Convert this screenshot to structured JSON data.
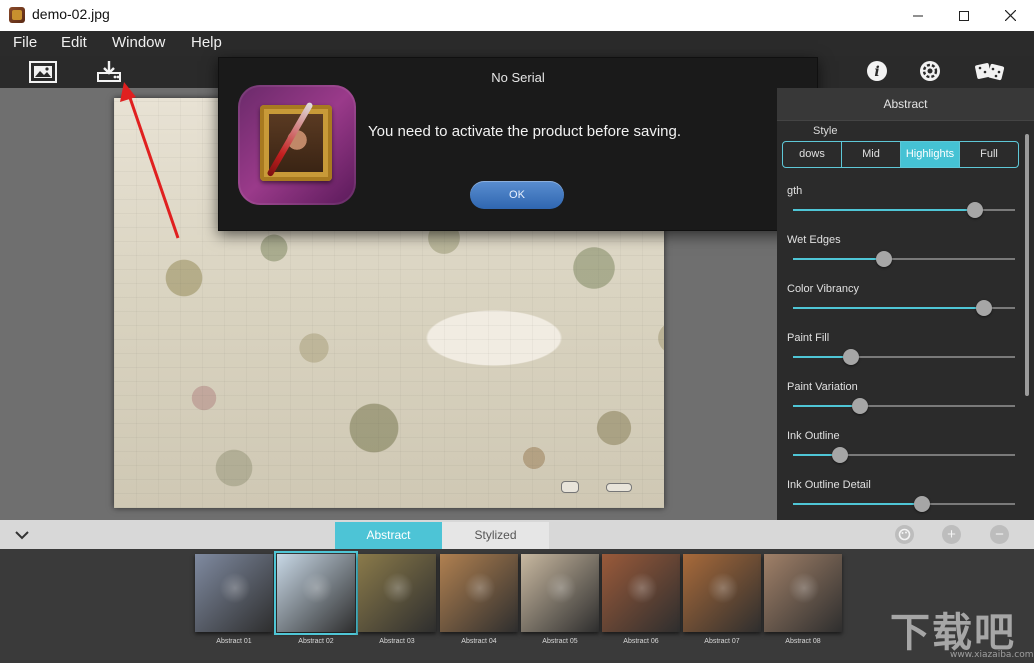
{
  "window": {
    "title": "demo-02.jpg"
  },
  "menu": [
    "File",
    "Edit",
    "Window",
    "Help"
  ],
  "toolbar": {
    "left_icons": [
      "image-icon",
      "save-download-icon"
    ],
    "right_icons": [
      "info-icon",
      "settings-gear-icon",
      "dice-icon"
    ]
  },
  "dialog": {
    "title": "No Serial",
    "message": "You need to activate the product before saving.",
    "ok_label": "OK"
  },
  "panel": {
    "title": "Abstract",
    "style_label": "Style",
    "style_options": [
      "dows",
      "Mid",
      "Highlights",
      "Full"
    ],
    "style_selected": "Highlights",
    "sliders": [
      {
        "label": "gth",
        "value": 0.82
      },
      {
        "label": "Wet Edges",
        "value": 0.41
      },
      {
        "label": "Color Vibrancy",
        "value": 0.86
      },
      {
        "label": "Paint Fill",
        "value": 0.26
      },
      {
        "label": "Paint Variation",
        "value": 0.3
      },
      {
        "label": "Ink Outline",
        "value": 0.21
      },
      {
        "label": "Ink Outline Detail",
        "value": 0.58
      }
    ]
  },
  "tabs": {
    "abstract": "Abstract",
    "stylized": "Stylized"
  },
  "bottom_buttons": {
    "add": "+",
    "remove": "−"
  },
  "thumbnails": [
    {
      "label": "Abstract 01",
      "color": "#7f8aa0"
    },
    {
      "label": "Abstract 02",
      "color": "#c8d8e6"
    },
    {
      "label": "Abstract 03",
      "color": "#8a7a4a"
    },
    {
      "label": "Abstract 04",
      "color": "#b08050"
    },
    {
      "label": "Abstract 05",
      "color": "#c8b8a0"
    },
    {
      "label": "Abstract 06",
      "color": "#9a5a3a"
    },
    {
      "label": "Abstract 07",
      "color": "#a86a3a"
    },
    {
      "label": "Abstract 08",
      "color": "#a08068"
    }
  ],
  "watermark": {
    "text": "下载吧",
    "url": "www.xiazaiba.com"
  },
  "colors": {
    "accent": "#4fc6d6",
    "ok_button": "#3a72bf",
    "arrow": "#e02020"
  }
}
